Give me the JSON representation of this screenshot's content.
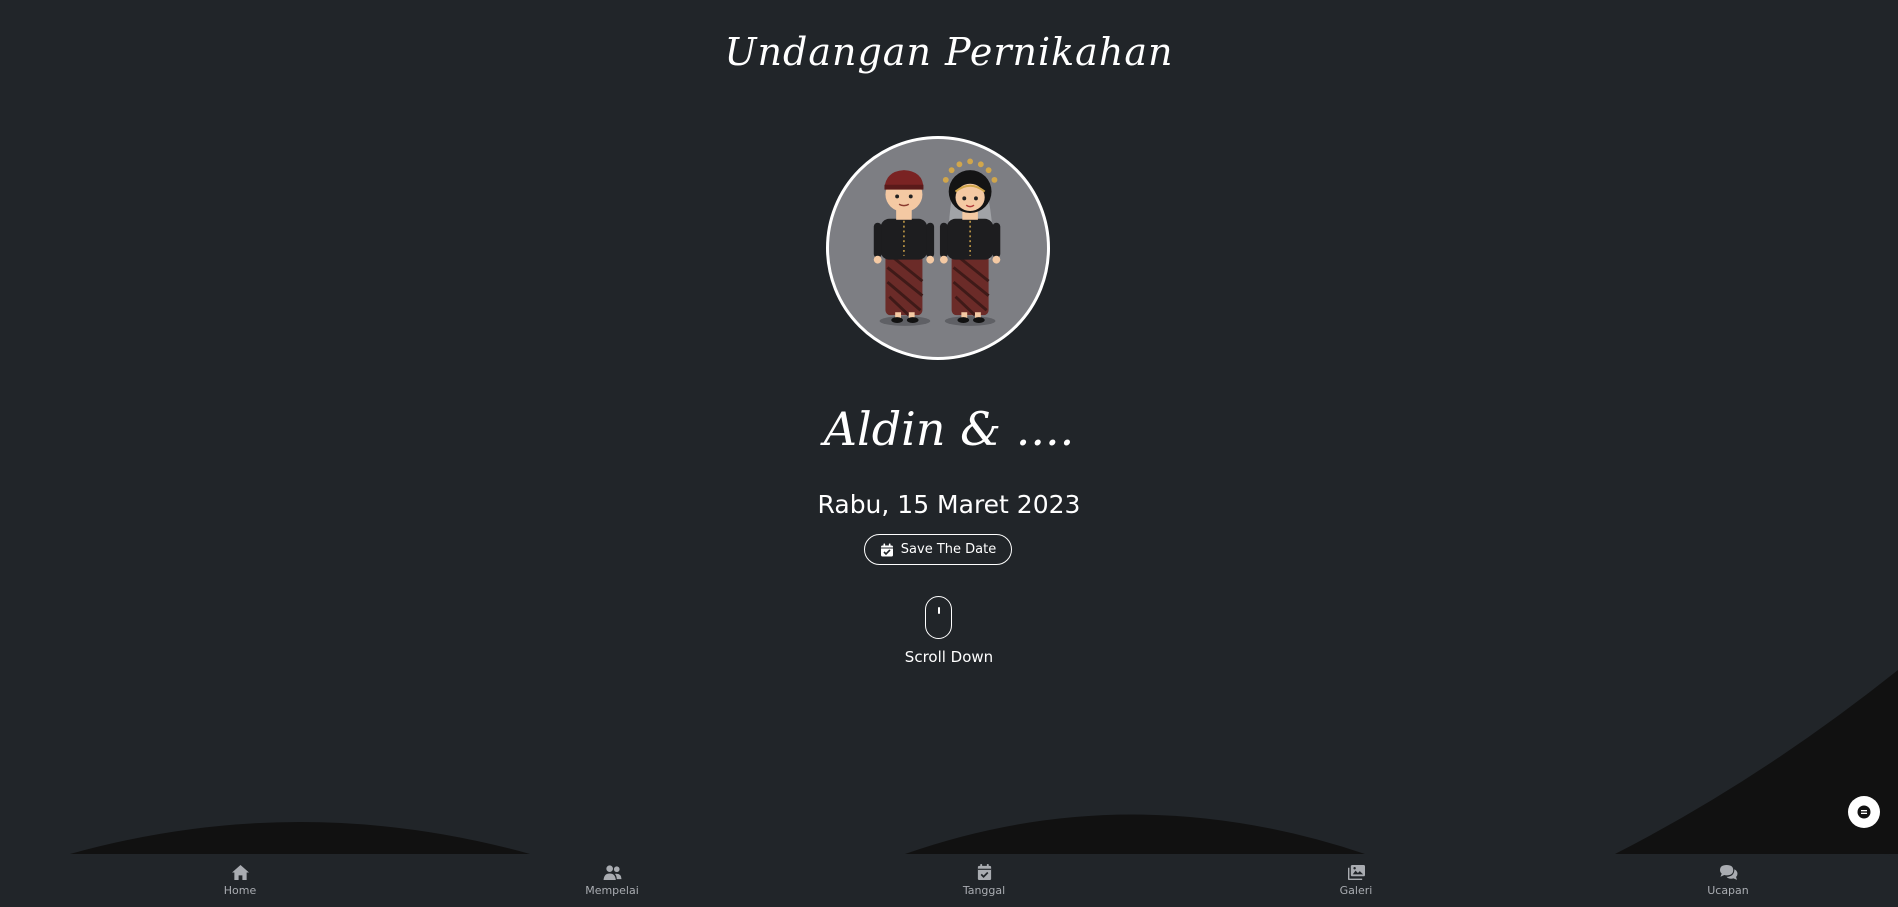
{
  "hero": {
    "title": "Undangan Pernikahan",
    "couple": "Aldin & ....",
    "date": "Rabu, 15 Maret 2023",
    "save_label": "Save The Date",
    "scroll_label": "Scroll Down"
  },
  "nav": {
    "items": [
      {
        "label": "Home",
        "icon": "home-icon"
      },
      {
        "label": "Mempelai",
        "icon": "users-icon"
      },
      {
        "label": "Tanggal",
        "icon": "calendar-check-icon"
      },
      {
        "label": "Galeri",
        "icon": "images-icon"
      },
      {
        "label": "Ucapan",
        "icon": "comments-icon"
      }
    ]
  },
  "colors": {
    "background": "#212529",
    "wave": "#111111",
    "avatar_bg": "#7d7e83",
    "nav_text": "#a9acb1"
  }
}
